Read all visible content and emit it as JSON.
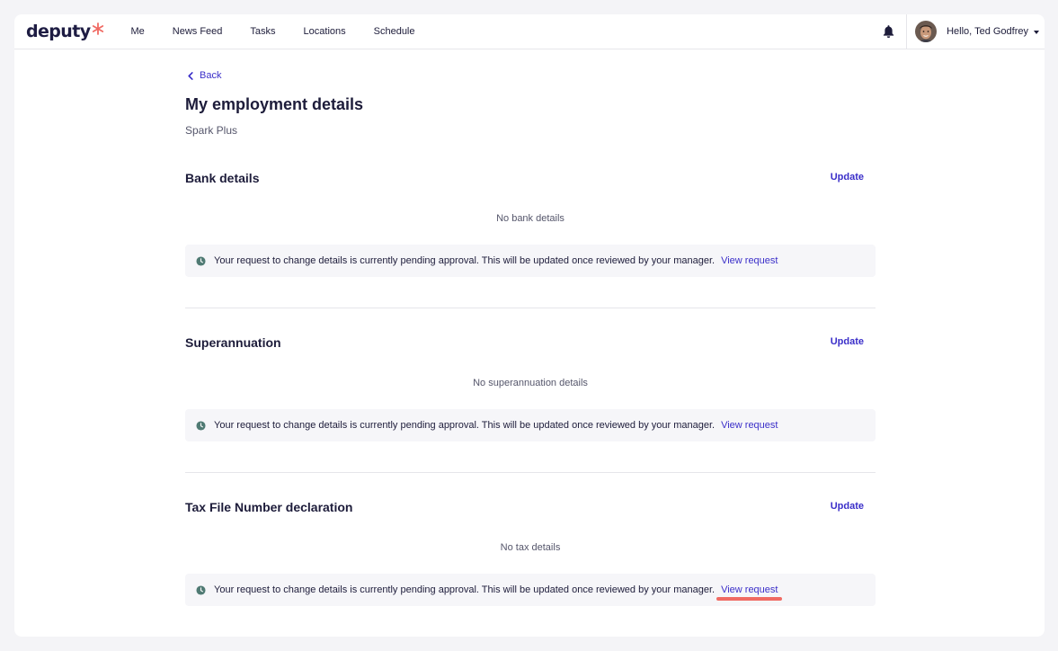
{
  "nav": {
    "logo": "deputy",
    "items": [
      {
        "label": "Me",
        "name": "nav-me"
      },
      {
        "label": "News Feed",
        "name": "nav-news-feed"
      },
      {
        "label": "Tasks",
        "name": "nav-tasks"
      },
      {
        "label": "Locations",
        "name": "nav-locations"
      },
      {
        "label": "Schedule",
        "name": "nav-schedule"
      }
    ],
    "greeting": "Hello, Ted Godfrey"
  },
  "page": {
    "back_label": "Back",
    "title": "My employment details",
    "subtitle": "Spark Plus"
  },
  "sections": [
    {
      "title": "Bank details",
      "update_label": "Update",
      "empty_message": "No bank details",
      "notice": "Your request to change details is currently pending approval. This will be updated once reviewed by your manager.",
      "link": "View request"
    },
    {
      "title": "Superannuation",
      "update_label": "Update",
      "empty_message": "No superannuation details",
      "notice": "Your request to change details is currently pending approval. This will be updated once reviewed by your manager.",
      "link": "View request"
    },
    {
      "title": "Tax File Number declaration",
      "update_label": "Update",
      "empty_message": "No tax details",
      "notice": "Your request to change details is currently pending approval. This will be updated once reviewed by your manager.",
      "link": "View request"
    }
  ],
  "colors": {
    "accent": "#3b2fc9",
    "logo_star": "#f06a63",
    "notice_bg": "#f6f6f9",
    "clock_icon": "#4f7a73",
    "highlight": "#f06a63"
  },
  "icons": [
    "deputy-star-icon",
    "bell-icon",
    "avatar",
    "chevron-left-icon",
    "clock-icon",
    "caret-down-icon"
  ]
}
